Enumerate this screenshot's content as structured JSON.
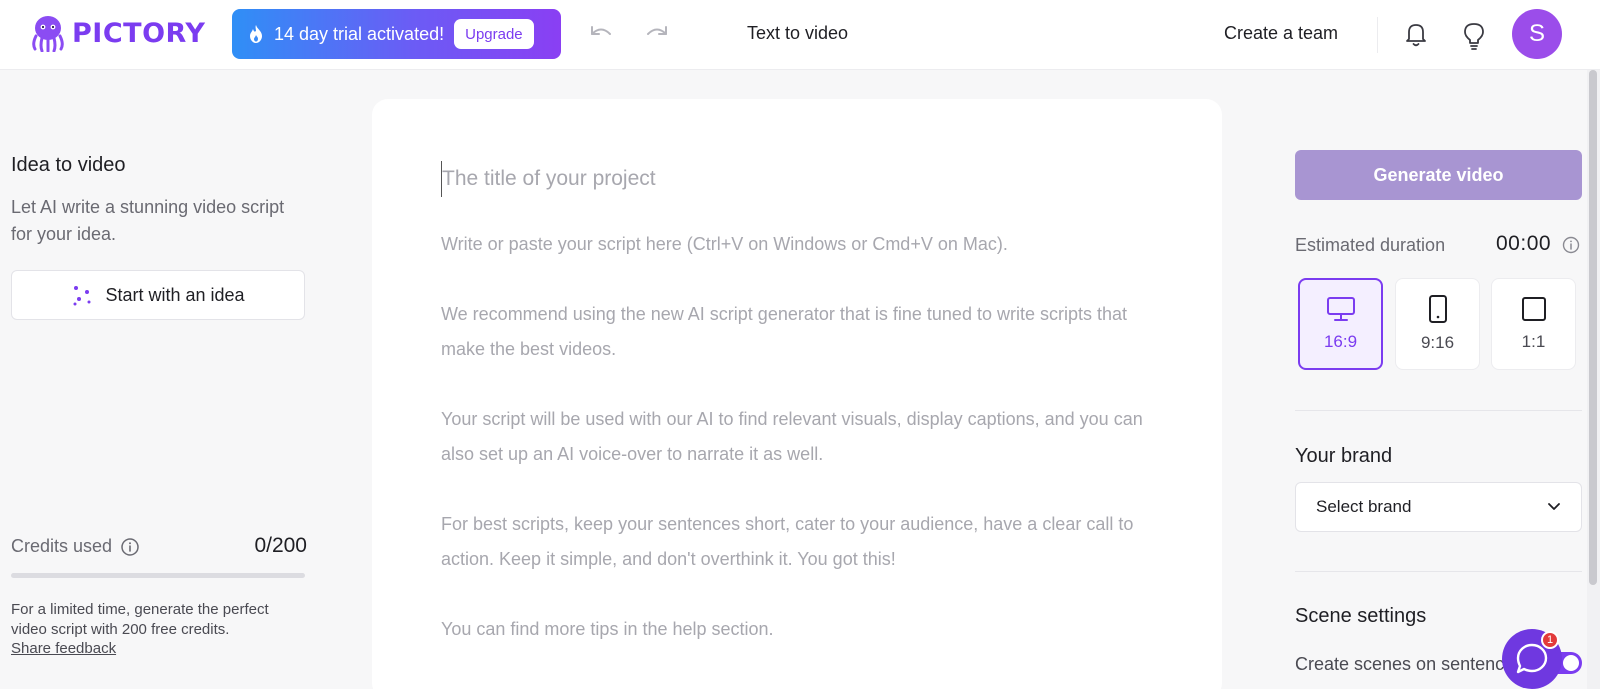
{
  "header": {
    "logo_text": "PICTORY",
    "trial_text": "14 day trial activated!",
    "upgrade_label": "Upgrade",
    "page_title": "Text to video",
    "create_team_label": "Create a team",
    "avatar_initial": "S"
  },
  "left_panel": {
    "idea_title": "Idea to video",
    "idea_description": "Let AI write a stunning video script for your idea.",
    "idea_button_label": "Start with an idea",
    "credits_label": "Credits used",
    "credits_value": "0/200",
    "credits_used_fraction": 0.0,
    "credits_note": "For a limited time, generate the perfect video script with 200 free credits.",
    "feedback_link": "Share feedback"
  },
  "editor": {
    "title_placeholder": "The title of your project",
    "script_placeholder": [
      "Write or paste your script here (Ctrl+V on Windows or Cmd+V on Mac).",
      "We recommend using the new AI script generator that is fine tuned to write scripts that make the best videos.",
      "Your script will be used with our AI to find relevant visuals, display captions, and you can also set up an AI voice-over to narrate it as well.",
      "For best scripts, keep your sentences short, cater to your audience, have a clear call to action. Keep it simple, and don't overthink it. You got this!",
      "You can find more tips in the help section."
    ]
  },
  "right_panel": {
    "generate_label": "Generate video",
    "duration_label": "Estimated duration",
    "duration_value": "00:00",
    "aspect_ratios": [
      {
        "label": "16:9",
        "icon": "monitor-icon",
        "selected": true
      },
      {
        "label": "9:16",
        "icon": "phone-icon",
        "selected": false
      },
      {
        "label": "1:1",
        "icon": "square-icon",
        "selected": false
      }
    ],
    "brand_label": "Your brand",
    "brand_select_value": "Select brand",
    "scene_settings_label": "Scene settings",
    "scene_option_label": "Create scenes on sentence",
    "scene_toggle_on": true
  },
  "chat": {
    "badge_count": "1"
  },
  "colors": {
    "accent": "#7b3cf0",
    "generate_disabled": "#a895d2",
    "trial_gradient_start": "#2f8ff6",
    "trial_gradient_end": "#8a3ff3"
  }
}
